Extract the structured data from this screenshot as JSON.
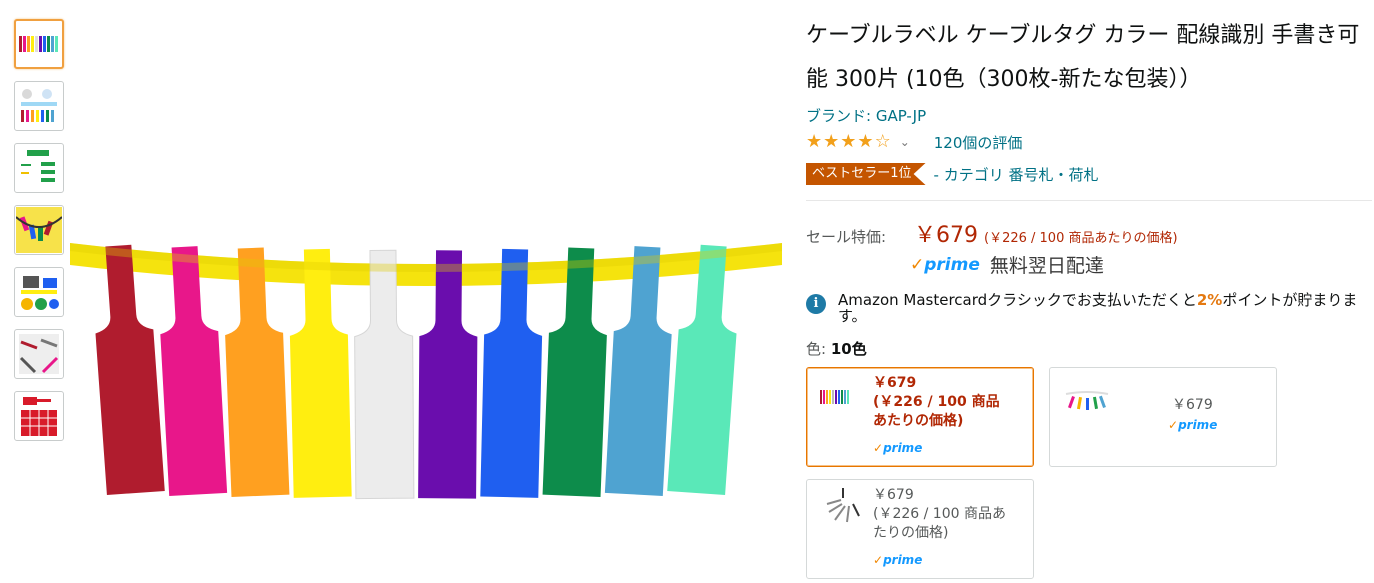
{
  "thumbnails": [
    {
      "name": "thumb-1-tags-row",
      "icon": "color-tags-thumbnail"
    },
    {
      "name": "thumb-2-infographic",
      "icon": "infographic-thumbnail"
    },
    {
      "name": "thumb-3-size-diagram",
      "icon": "size-diagram-thumbnail"
    },
    {
      "name": "thumb-4-cables",
      "icon": "cables-thumbnail"
    },
    {
      "name": "thumb-5-printer",
      "icon": "printer-thumbnail"
    },
    {
      "name": "thumb-6-usage",
      "icon": "usage-thumbnail"
    },
    {
      "name": "thumb-7-sheet",
      "icon": "sheet-thumbnail"
    }
  ],
  "main_image": {
    "tag_colors": [
      "#b01c2e",
      "#e8178a",
      "#ffa020",
      "#ffee10",
      "#ececec",
      "#6a0dad",
      "#1f5ff0",
      "#0d8c4b",
      "#4fa3d1",
      "#5ae8b8"
    ],
    "ring_color": "#f5e30e"
  },
  "product": {
    "title": "ケーブルラベル ケーブルタグ カラー 配線識別 手書き可能 300片 (10色（300枚-新たな包装））",
    "brand": "ブランド: GAP-JP",
    "rating_value": 4,
    "rating_count": "120個の評価",
    "badge": "ベストセラー1位",
    "category": "- カテゴリ 番号札・荷札",
    "price_label": "セール特価:",
    "price": "￥679",
    "unit_price": "(￥226 / 100 商品あたりの価格)",
    "prime": "prime",
    "shipping": "無料翌日配達",
    "info_text_before": "Amazon Mastercardクラシックでお支払いただくと",
    "info_pct": "2%",
    "info_text_after": "ポイントが貯まります。",
    "color_label": "色:",
    "color_value": "10色"
  },
  "swatches": [
    {
      "price": "￥679",
      "unit_line1": "(￥226 / 100 商品",
      "unit_line2": "あたりの価格)",
      "prime": "prime",
      "selected": true
    },
    {
      "price": "￥679",
      "prime": "prime",
      "selected": false
    },
    {
      "price": "￥679",
      "unit_line1": "(￥226 / 100 商品あ",
      "unit_line2": "たりの価格)",
      "prime": "prime",
      "selected": false
    }
  ],
  "colors": {
    "link": "#007185",
    "price": "#b12704",
    "badge": "#c45500",
    "prime": "#1399ff",
    "star": "#f2a01b"
  }
}
